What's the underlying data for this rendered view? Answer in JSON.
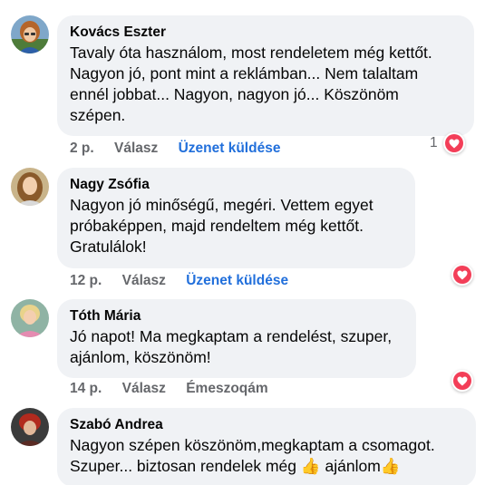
{
  "colors": {
    "bubble": "#f0f2f5",
    "link": "#216fdb",
    "meta": "#65676b",
    "heart": "#f33e58"
  },
  "comments": [
    {
      "author": "Kovács Eszter",
      "text": "Tavaly óta használom, most rendeletem még kettőt.\nNagyon jó, pont mint a reklámban... Nem talaltam\nennél jobbat... Nagyon, nagyon jó... Köszönöm\nszépen.",
      "time": "2 p.",
      "reply": "Válasz",
      "action": "Üzenet küldése",
      "reaction_count": "1",
      "reaction_icon": "heart-icon"
    },
    {
      "author": "Nagy Zsófia",
      "text": "Nagyon jó minőségű, megéri. Vettem egyet\npróbaképpen, majd rendeltem még kettőt.\nGratulálok!",
      "time": "12 p.",
      "reply": "Válasz",
      "action": "Üzenet küldése",
      "reaction_icon": "heart-icon"
    },
    {
      "author": "Tóth Mária",
      "text": "Jó napot! Ma megkaptam a rendelést, szuper,\najánlom, köszönöm!",
      "time": "14 p.",
      "reply": "Válasz",
      "action": "Émeszoqám",
      "reaction_icon": "heart-icon"
    },
    {
      "author": "Szabó Andrea",
      "text": "Nagyon szépen köszönöm,megkaptam a csomagot.\nSzuper... biztosan rendelek még 👍 ajánlom👍"
    }
  ]
}
